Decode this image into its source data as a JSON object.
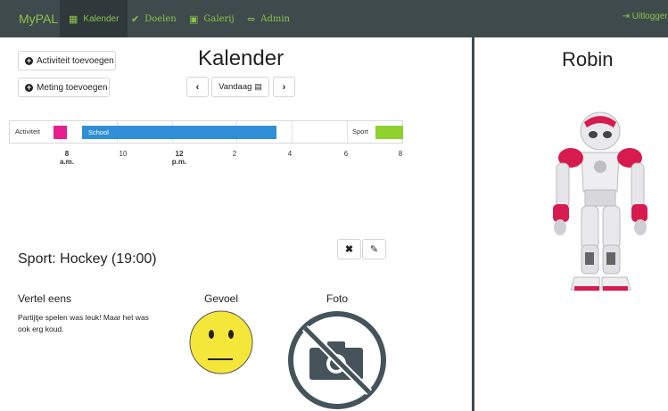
{
  "navbar": {
    "brand": "MyPAL",
    "items": [
      {
        "label": "Kalender",
        "icon": "calendar-icon"
      },
      {
        "label": "Doelen",
        "icon": "check-icon"
      },
      {
        "label": "Galerij",
        "icon": "image-icon"
      },
      {
        "label": "Admin",
        "icon": "link-icon"
      }
    ],
    "logout_label": "Uitloggen",
    "logout_icon": "logout-icon"
  },
  "calendar": {
    "title": "Kalender",
    "add_activity_label": "Activiteit toevoegen",
    "add_measurement_label": "Meting toevoegen",
    "today_label": "Vandaag",
    "prev_icon": "chevron-left-icon",
    "next_icon": "chevron-right-icon"
  },
  "timeline": {
    "row_label": "Activiteit",
    "events": [
      {
        "label": "",
        "color": "#e91e8c",
        "start_hour": 7.5,
        "end_hour": 8.0
      },
      {
        "label": "School",
        "color": "#2f8fd6",
        "start_hour": 8.5,
        "end_hour": 15.6
      },
      {
        "label": "Sport",
        "color": "#8ed12e",
        "start_hour": 19.0,
        "end_hour": 20.0
      }
    ],
    "ticks": [
      {
        "value": "8",
        "sub": "a.m."
      },
      {
        "value": "10",
        "sub": ""
      },
      {
        "value": "12",
        "sub": "p.m."
      },
      {
        "value": "2",
        "sub": ""
      },
      {
        "value": "4",
        "sub": ""
      },
      {
        "value": "6",
        "sub": ""
      },
      {
        "value": "8",
        "sub": ""
      }
    ]
  },
  "event": {
    "title": "Sport: Hockey (19:00)",
    "tell_heading": "Vertel eens",
    "tell_text": "Partijtje spelen was leuk! Maar het was ook erg koud.",
    "feeling_heading": "Gevoel",
    "feeling_icon": "neutral-face-icon",
    "photo_heading": "Foto",
    "photo_icon": "no-camera-icon"
  },
  "robot": {
    "name": "Robin"
  },
  "colors": {
    "navbar": "#3f4a4d",
    "accent": "#8bc34a"
  }
}
